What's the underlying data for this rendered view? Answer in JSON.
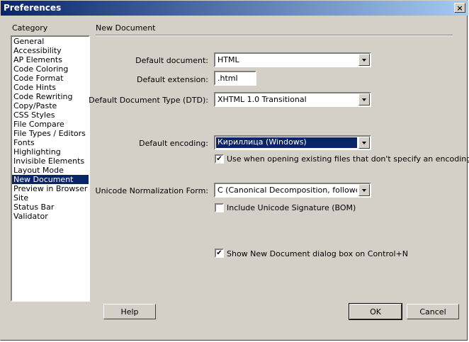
{
  "window": {
    "title": "Preferences",
    "close_glyph": "×"
  },
  "category": {
    "label": "Category",
    "items": [
      "General",
      "Accessibility",
      "AP Elements",
      "Code Coloring",
      "Code Format",
      "Code Hints",
      "Code Rewriting",
      "Copy/Paste",
      "CSS Styles",
      "File Compare",
      "File Types / Editors",
      "Fonts",
      "Highlighting",
      "Invisible Elements",
      "Layout Mode",
      "New Document",
      "Preview in Browser",
      "Site",
      "Status Bar",
      "Validator"
    ],
    "selected": "New Document"
  },
  "panel": {
    "title": "New Document",
    "default_document": {
      "label": "Default document:",
      "value": "HTML"
    },
    "default_extension": {
      "label": "Default extension:",
      "value": ".html"
    },
    "dtd": {
      "label": "Default Document Type (DTD):",
      "value": "XHTML 1.0 Transitional"
    },
    "encoding": {
      "label": "Default encoding:",
      "value": "Кириллица (Windows)"
    },
    "use_encoding_checkbox": {
      "label": "Use when opening existing files that don't specify an encoding",
      "checked": true
    },
    "unicode_form": {
      "label": "Unicode Normalization Form:",
      "value": "C (Canonical Decomposition, followed by C"
    },
    "unicode_signature": {
      "label": "Include Unicode Signature (BOM)",
      "checked": false
    },
    "show_dialog": {
      "label": "Show New Document dialog box on Control+N",
      "checked": true
    }
  },
  "buttons": {
    "help": "Help",
    "ok": "OK",
    "cancel": "Cancel"
  },
  "checkmark_glyph": "✔",
  "colors": {
    "selection": "#0a246a",
    "face": "#d4d0c8"
  }
}
